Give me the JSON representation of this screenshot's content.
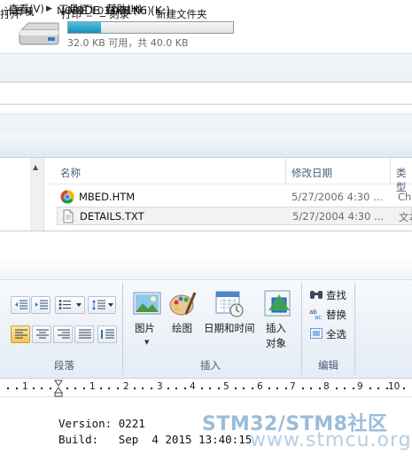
{
  "drive": {
    "name": "NODE_L031K6 (K:)",
    "capacity_text": "32.0 KB 可用，共 40.0 KB",
    "used_fraction": 0.2
  },
  "address": {
    "computer": "计算机",
    "drive": "NODE_L031K6 (K:)"
  },
  "menu": {
    "view": "查看(V)",
    "tools": "工具(T)",
    "help": "帮助(H)"
  },
  "commands": {
    "open": "打开",
    "print": "打印",
    "burn": "刻录",
    "new_folder": "新建文件夹"
  },
  "columns": {
    "name": "名称",
    "date": "修改日期",
    "type": "类型"
  },
  "files": [
    {
      "name": "MBED.HTM",
      "date": "5/27/2006 4:30 ...",
      "type": "Ch",
      "icon": "chrome-icon"
    },
    {
      "name": "DETAILS.TXT",
      "date": "5/27/2004 4:30 ...",
      "type": "文本",
      "icon": "text-file-icon"
    }
  ],
  "ribbon": {
    "groups": {
      "paragraph": "段落",
      "insert": "插入",
      "edit": "编辑"
    },
    "insert": {
      "picture": "图片",
      "paint": "绘图",
      "datetime": "日期和时间",
      "object_line1": "插入",
      "object_line2": "对象"
    },
    "edit": {
      "find": "查找",
      "replace": "替换",
      "select_all": "全选"
    }
  },
  "ruler": {
    "numbers": [
      "1",
      "1",
      "2",
      "3",
      "4",
      "5",
      "6",
      "7",
      "8",
      "9",
      "10"
    ]
  },
  "document": {
    "version_line": "Version: 0221",
    "build_line": "Build:   Sep  4 2015 13:40:15"
  },
  "watermark": {
    "line1": "STM32/STM8社区",
    "line2": "www.stmcu.org"
  },
  "colors": {
    "progress": "#26a0cf",
    "ribbon_active": "#f6c54d",
    "watermark": "#7aa5cd"
  }
}
